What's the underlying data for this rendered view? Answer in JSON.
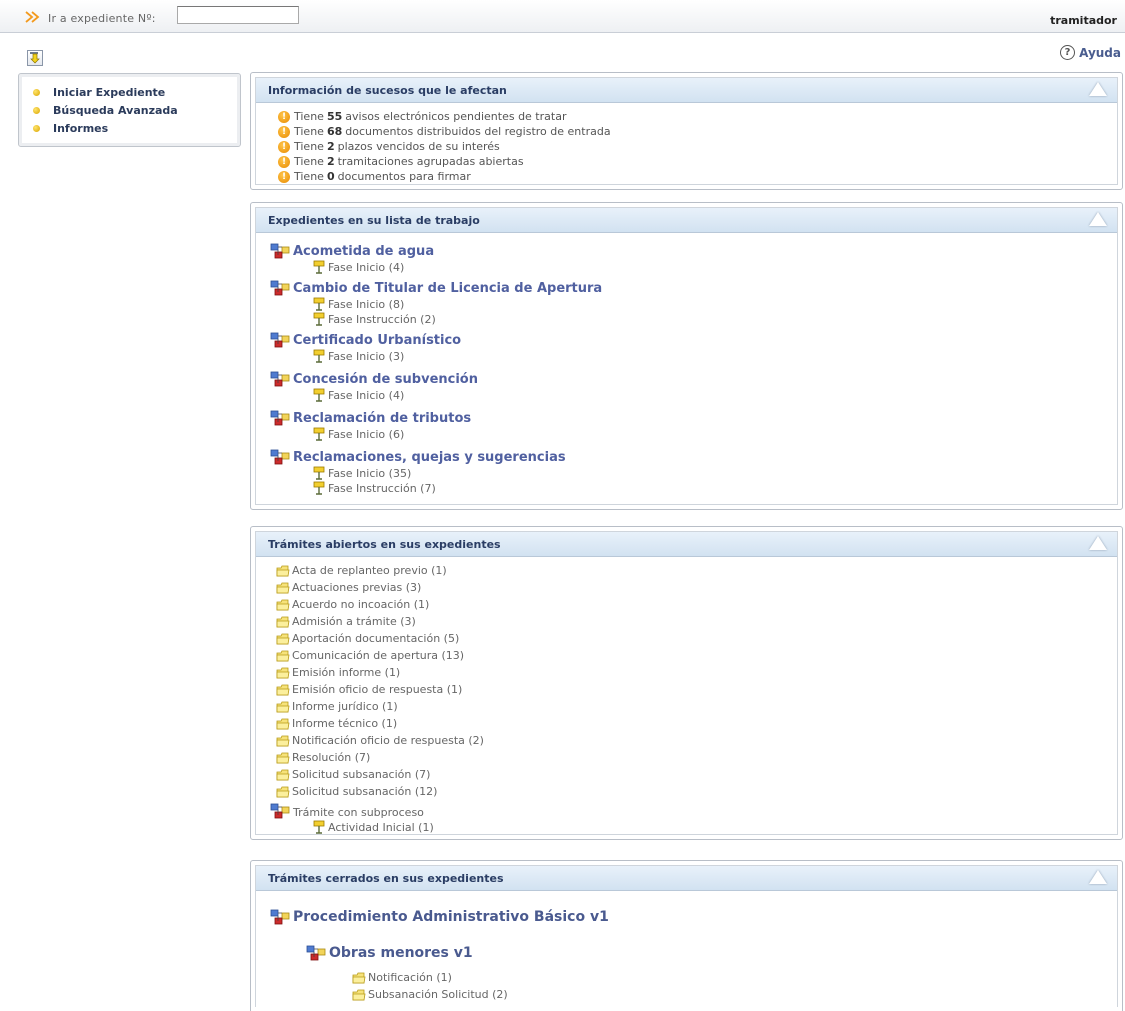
{
  "topbar": {
    "goto_label": "Ir a expediente Nº:",
    "goto_value": "",
    "user": "tramitador"
  },
  "help": {
    "label": "Ayuda"
  },
  "left_menu": {
    "items": [
      "Iniciar Expediente",
      "Búsqueda Avanzada",
      "Informes"
    ]
  },
  "events_panel": {
    "title": "Información de sucesos que le afectan",
    "items": [
      {
        "prefix": "Tiene",
        "count": "55",
        "text": "avisos electrónicos pendientes de tratar"
      },
      {
        "prefix": "Tiene",
        "count": "68",
        "text": "documentos distribuidos del registro de entrada"
      },
      {
        "prefix": "Tiene",
        "count": "2",
        "text": "plazos vencidos de su interés"
      },
      {
        "prefix": "Tiene",
        "count": "2",
        "text": "tramitaciones agrupadas abiertas"
      },
      {
        "prefix": "Tiene",
        "count": "0",
        "text": "documentos para firmar"
      }
    ]
  },
  "worklist_panel": {
    "title": "Expedientes en su lista de trabajo",
    "procedures": [
      {
        "name": "Acometida de agua",
        "phases": [
          "Fase Inicio (4)"
        ]
      },
      {
        "name": "Cambio de Titular de Licencia de Apertura",
        "phases": [
          "Fase Inicio (8)",
          "Fase Instrucción (2)"
        ]
      },
      {
        "name": "Certificado Urbanístico",
        "phases": [
          "Fase Inicio (3)"
        ]
      },
      {
        "name": "Concesión de subvención",
        "phases": [
          "Fase Inicio (4)"
        ]
      },
      {
        "name": "Reclamación de tributos",
        "phases": [
          "Fase Inicio (6)"
        ]
      },
      {
        "name": "Reclamaciones, quejas y sugerencias",
        "phases": [
          "Fase Inicio (35)",
          "Fase Instrucción (7)"
        ]
      }
    ]
  },
  "open_tasks_panel": {
    "title": "Trámites abiertos en sus expedientes",
    "tasks": [
      "Acta de replanteo previo (1)",
      "Actuaciones previas (3)",
      "Acuerdo no incoación (1)",
      "Admisión a trámite (3)",
      "Aportación documentación (5)",
      "Comunicación de apertura (13)",
      "Emisión informe (1)",
      "Emisión oficio de respuesta (1)",
      "Informe jurídico (1)",
      "Informe técnico (1)",
      "Notificación oficio de respuesta (2)",
      "Resolución (7)",
      "Solicitud subsanación (7)",
      "Solicitud subsanación (12)"
    ],
    "subprocess": {
      "name": "Trámite con subproceso",
      "activity": "Actividad Inicial (1)"
    }
  },
  "closed_tasks_panel": {
    "title": "Trámites cerrados en sus expedientes",
    "procedure": "Procedimiento Administrativo Básico v1",
    "subprocedure": "Obras menores v1",
    "tasks": [
      "Notificación (1)",
      "Subsanación Solicitud (2)"
    ]
  },
  "colors": {
    "header_bg": "#d2e2f1",
    "title_text": "#2a3d64",
    "procedure_link": "#5060a0",
    "warning": "#e88a00"
  }
}
